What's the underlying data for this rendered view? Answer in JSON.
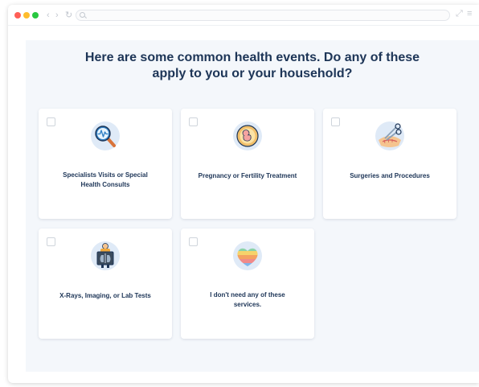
{
  "browser": {
    "nav_back": "‹",
    "nav_forward": "›",
    "nav_reload": "↻",
    "expand_icon": "⤢",
    "menu_icon": "≡"
  },
  "page": {
    "title_line1": "Here are some common health events. Do any of these",
    "title_line2": "apply to you or your household?"
  },
  "cards": [
    {
      "label_line1": "Specialists Visits or Special",
      "label_line2": "Health Consults",
      "icon": "magnifier-pulse-icon",
      "checked": false
    },
    {
      "label_line1": "Pregnancy or Fertility Treatment",
      "label_line2": "",
      "icon": "fetus-icon",
      "checked": false
    },
    {
      "label_line1": "Surgeries and Procedures",
      "label_line2": "",
      "icon": "scissors-incision-icon",
      "checked": false
    },
    {
      "label_line1": "X-Rays, Imaging, or Lab Tests",
      "label_line2": "",
      "icon": "xray-icon",
      "checked": false
    },
    {
      "label_line1": "I don't need any of these",
      "label_line2": "services.",
      "icon": "rainbow-heart-icon",
      "checked": false
    }
  ],
  "colors": {
    "title": "#1d3557",
    "panel_bg": "#f4f7fb",
    "card_bg": "#ffffff",
    "icon_circle": "#dfeaf7"
  }
}
